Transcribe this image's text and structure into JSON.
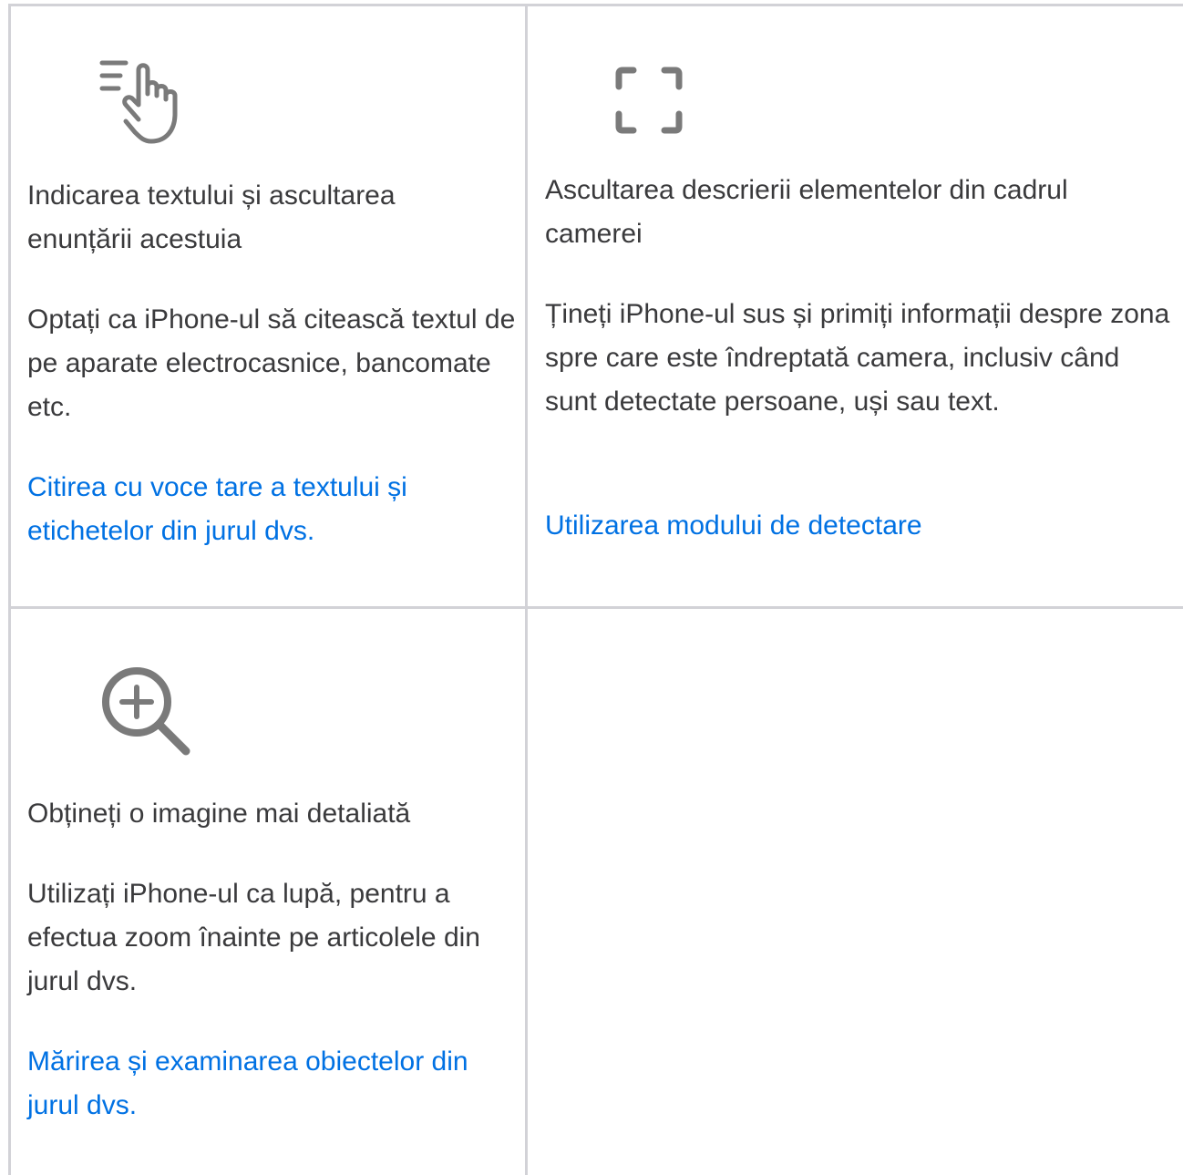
{
  "cards": [
    {
      "icon": "point-and-speak-icon",
      "title": "Indicarea textului și ascultarea enunțării acestuia",
      "description": "Optați ca iPhone-ul să citească textul de pe aparate electrocasnice, bancomate etc.",
      "link": "Citirea cu voce tare a textului și etichetelor din jurul dvs."
    },
    {
      "icon": "viewfinder-icon",
      "title": "Ascultarea descrierii elementelor din cadrul camerei",
      "description": "Țineți iPhone-ul sus și primiți informații despre zona spre care este îndreptată camera, inclusiv când sunt detectate persoane, uși sau text.",
      "link": "Utilizarea modului de detectare"
    },
    {
      "icon": "magnifier-plus-icon",
      "title": "Obțineți o imagine mai detaliată",
      "description": "Utilizați iPhone-ul ca lupă, pentru a efectua zoom înainte pe articolele din jurul dvs.",
      "link": "Mărirea și examinarea obiectelor din jurul dvs."
    }
  ],
  "colors": {
    "text": "#3a3a3c",
    "link": "#0071e3",
    "border": "#d2d2d7",
    "icon": "#7a7a7a"
  }
}
